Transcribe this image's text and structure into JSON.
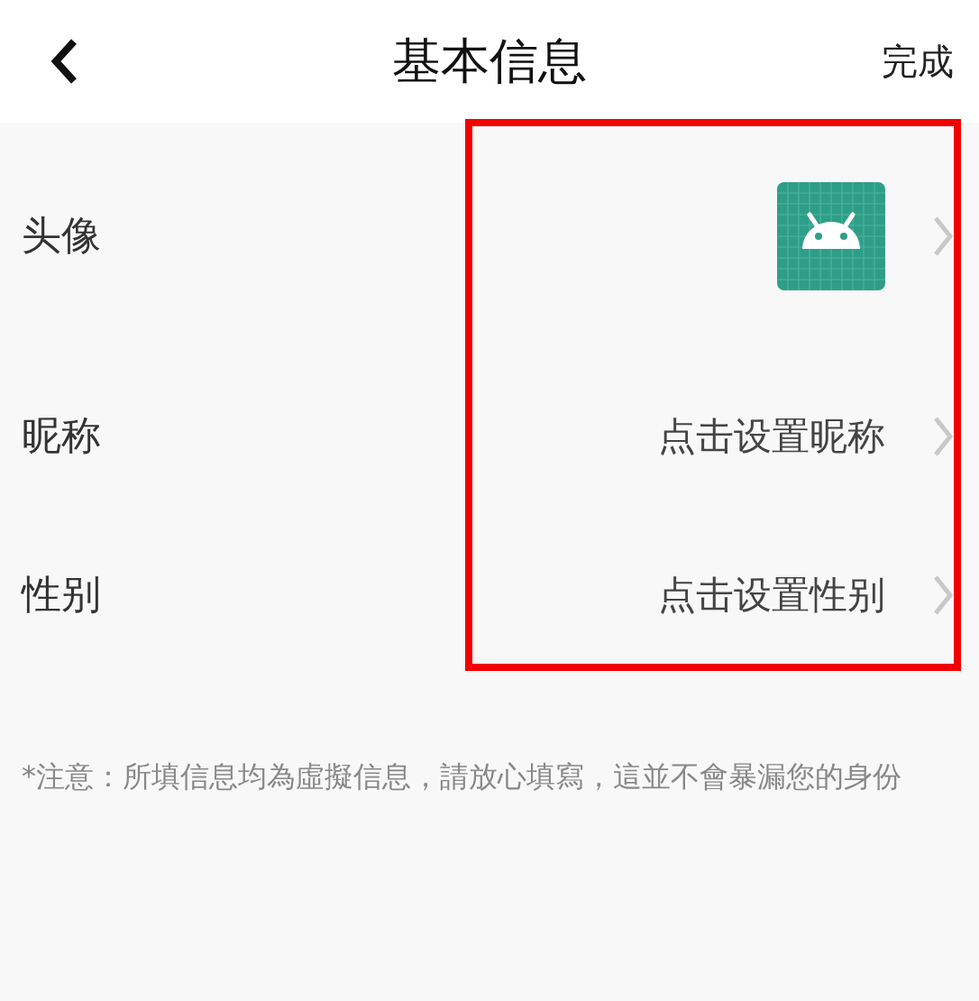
{
  "header": {
    "title": "基本信息",
    "action": "完成"
  },
  "rows": [
    {
      "kind": "avatar",
      "label": "头像"
    },
    {
      "kind": "text",
      "label": "昵称",
      "value": "点击设置昵称"
    },
    {
      "kind": "text",
      "label": "性别",
      "value": "点击设置性别"
    }
  ],
  "note": "*注意：所填信息均為虛擬信息，請放心填寫，這並不會暴漏您的身份"
}
